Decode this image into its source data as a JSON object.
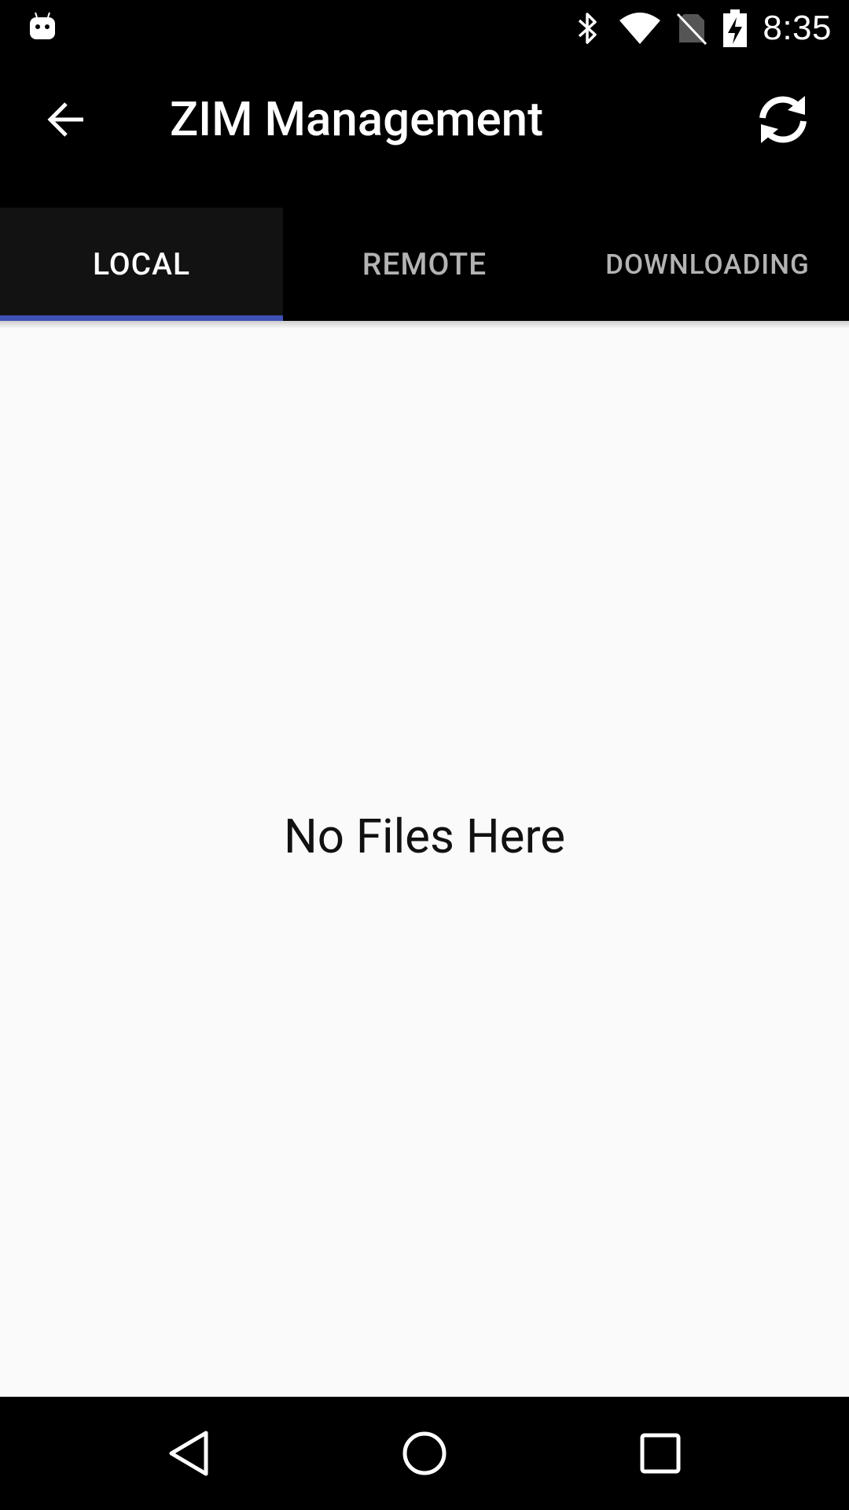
{
  "status_bar": {
    "time": "8:35",
    "icons": [
      "android-notification-icon",
      "bluetooth-icon",
      "wifi-icon",
      "no-sim-icon",
      "battery-charging-icon"
    ]
  },
  "app_bar": {
    "title": "ZIM Management",
    "back_icon": "arrow-back-icon",
    "refresh_icon": "refresh-icon"
  },
  "tabs": [
    {
      "label": "LOCAL",
      "selected": true
    },
    {
      "label": "REMOTE",
      "selected": false
    },
    {
      "label": "DOWNLOADING",
      "selected": false
    }
  ],
  "content": {
    "empty_message": "No Files Here"
  },
  "colors": {
    "tab_indicator": "#3f51b5",
    "content_background": "#fafafa",
    "bar_background": "#000000"
  },
  "nav_bar": {
    "icons": [
      "nav-back-icon",
      "nav-home-icon",
      "nav-recents-icon"
    ]
  }
}
